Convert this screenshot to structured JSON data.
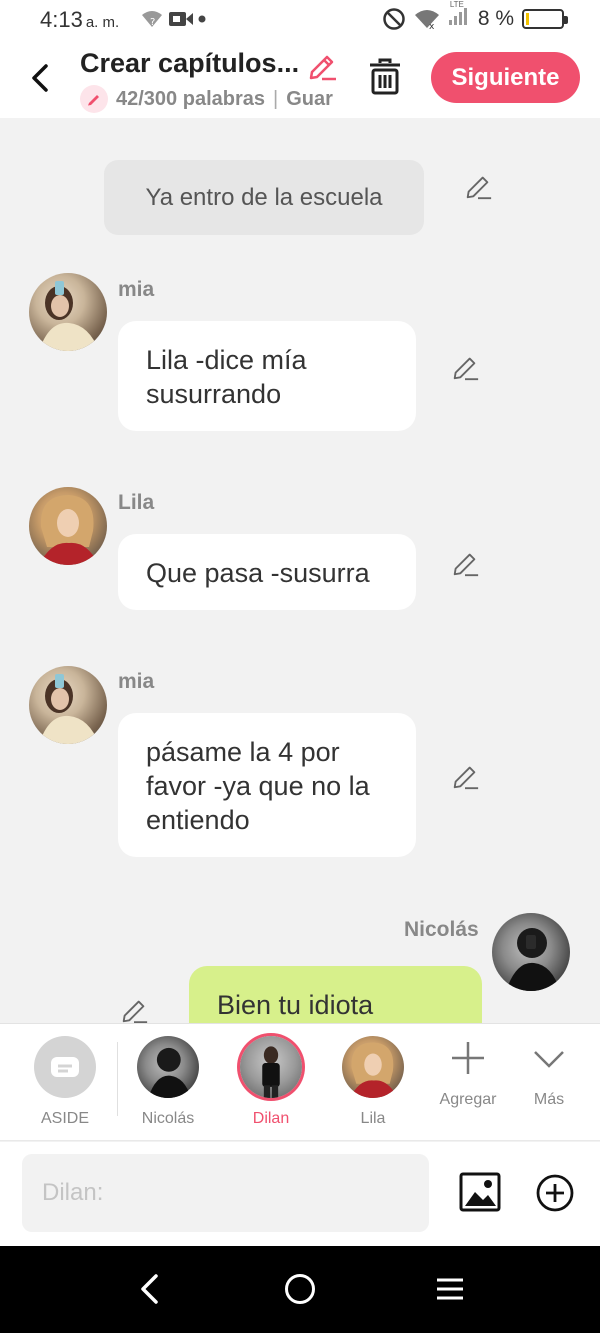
{
  "status_bar": {
    "time": "4:13",
    "ampm": "a. m.",
    "battery": "8 %",
    "network": "LTE"
  },
  "header": {
    "title": "Crear capítulos...",
    "word_count": "42/300 palabras",
    "save_status": "Guar",
    "next_label": "Siguiente"
  },
  "chat": {
    "narration": "Ya entro de la escuela",
    "messages": [
      {
        "speaker": "mia",
        "text_lines": [
          "Lila -dice mía",
          "susurrando"
        ]
      },
      {
        "speaker": "Lila",
        "text_lines": [
          "Que pasa -susurra"
        ]
      },
      {
        "speaker": "mia",
        "text_lines": [
          "pásame la 4 por",
          "favor -ya que no la",
          "entiendo"
        ]
      },
      {
        "speaker": "Nicolás",
        "text_lines": [
          "Bien tu idiota"
        ]
      }
    ]
  },
  "characters": [
    {
      "label": "ASIDE"
    },
    {
      "label": "Nicolás"
    },
    {
      "label": "Dilan",
      "selected": true
    },
    {
      "label": "Lila"
    }
  ],
  "actions": {
    "add_label": "Agregar",
    "more_label": "Más"
  },
  "input": {
    "placeholder": "Dilan:"
  },
  "colors": {
    "accent": "#f0506e",
    "right_bubble": "#d7f08b",
    "background": "#f2f2f2"
  }
}
